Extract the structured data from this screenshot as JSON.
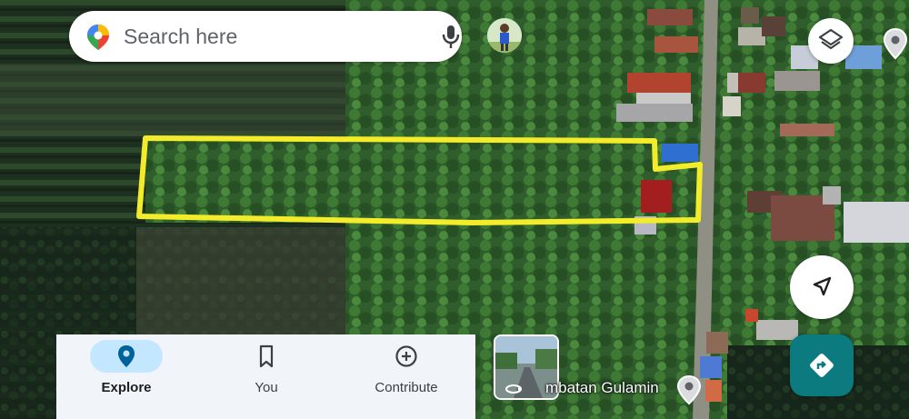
{
  "search": {
    "placeholder": "Search here"
  },
  "nav": {
    "items": [
      {
        "label": "Explore",
        "icon": "location-pin-icon",
        "active": true
      },
      {
        "label": "You",
        "icon": "bookmark-icon",
        "active": false
      },
      {
        "label": "Contribute",
        "icon": "add-circle-icon",
        "active": false
      }
    ]
  },
  "map": {
    "view": "satellite",
    "place_label": "mbatan Gulamin",
    "highlight_color": "#f2ec2b"
  },
  "colors": {
    "accent": "#0b7b80",
    "nav_active_pill": "#c2e7ff",
    "nav_active_icon": "#00629b"
  }
}
